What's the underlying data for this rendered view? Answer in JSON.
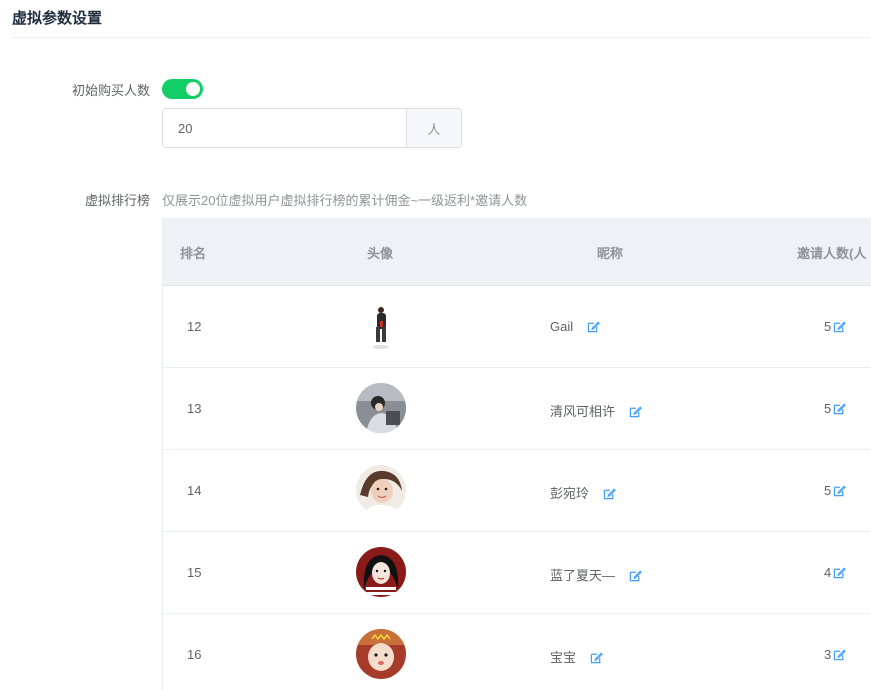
{
  "section": {
    "title": "虚拟参数设置"
  },
  "initial_buyers": {
    "label": "初始购买人数",
    "enabled": true,
    "value": "20",
    "unit": "人"
  },
  "ranking": {
    "label": "虚拟排行榜",
    "hint": "仅展示20位虚拟用户虚拟排行榜的累计佣金~一级返利*邀请人数",
    "columns": {
      "rank": "排名",
      "avatar": "头像",
      "nickname": "昵称",
      "invites": "邀请人数(人"
    },
    "rows": [
      {
        "rank": "12",
        "nickname": "Gail",
        "invites": "5"
      },
      {
        "rank": "13",
        "nickname": "清风可相许",
        "invites": "5"
      },
      {
        "rank": "14",
        "nickname": "彭宛玲",
        "invites": "5"
      },
      {
        "rank": "15",
        "nickname": "蓝了夏天—",
        "invites": "4"
      },
      {
        "rank": "16",
        "nickname": "宝宝",
        "invites": "3"
      }
    ]
  },
  "colors": {
    "toggle_on": "#13ce66",
    "edit_icon": "#409eff",
    "header_bg": "#eef1f6"
  },
  "icons": {
    "edit": "edit-icon"
  }
}
